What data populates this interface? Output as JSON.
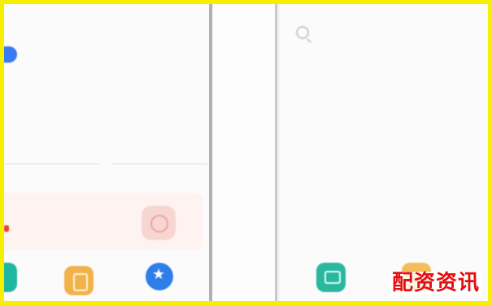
{
  "left_panel": {
    "tiny_line_1": "",
    "tiny_line_2": "",
    "pill_label": "",
    "section_label": "",
    "promo_text": "",
    "promo_accent": "#d23c2c"
  },
  "right_panel": {
    "search_placeholder": "",
    "hint_text": ""
  },
  "watermark": {
    "text": "配资资讯",
    "color": "#e30e12"
  },
  "colors": {
    "border": "#f6f000",
    "pill": "#3a7bf2",
    "icon_green": "#1fb7a2",
    "icon_orange": "#f1b24b",
    "icon_blue": "#2e7ee9"
  },
  "icons": [
    "search-icon",
    "promo-app-icon",
    "teal-app-icon",
    "orange-app-icon",
    "blue-star-icon"
  ]
}
